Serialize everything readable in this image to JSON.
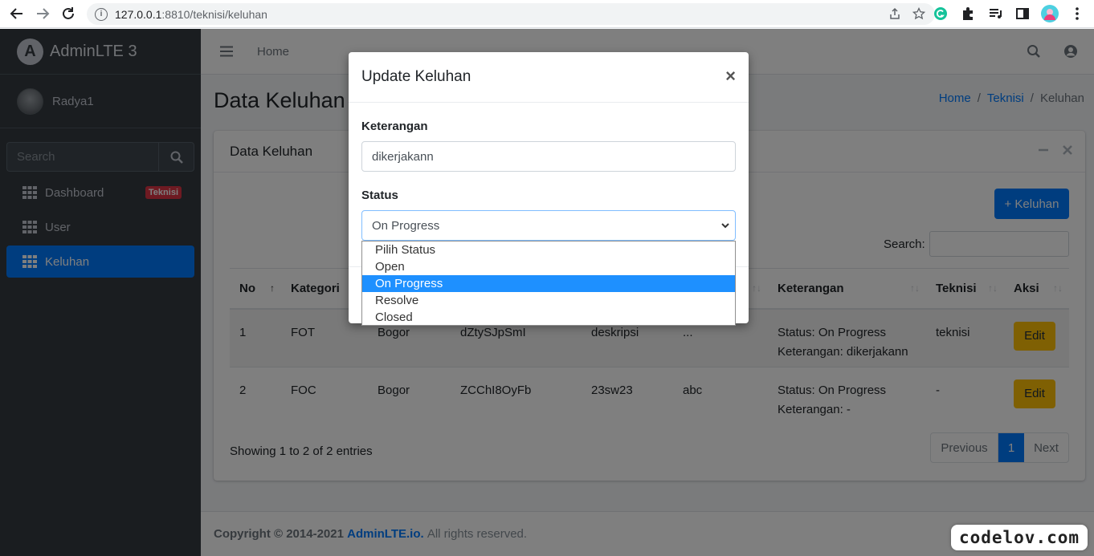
{
  "browser": {
    "url_host": "127.0.0.1",
    "url_path": ":8810/teknisi/keluhan"
  },
  "sidebar": {
    "brand": "AdminLTE 3",
    "user_name": "Radya1",
    "search_placeholder": "Search",
    "items": [
      {
        "label": "Dashboard",
        "badge": "Teknisi"
      },
      {
        "label": "User"
      },
      {
        "label": "Keluhan",
        "active": true
      }
    ]
  },
  "navbar": {
    "home": "Home"
  },
  "page": {
    "title": "Data Keluhan",
    "breadcrumb": [
      "Home",
      "Teknisi",
      "Keluhan"
    ]
  },
  "card": {
    "title": "Data Keluhan",
    "add_button": "+ Keluhan",
    "search_label": "Search:",
    "columns": [
      "No",
      "Kategori",
      "",
      "",
      "",
      "",
      "Keterangan",
      "Teknisi",
      "Aksi"
    ],
    "rows": [
      {
        "no": "1",
        "kategori": "FOT",
        "c3": "Bogor",
        "c4": "dZtySJpSmI",
        "c5": "deskripsi",
        "c6": "...",
        "status": "Status: On Progress",
        "keterangan": "Keterangan: dikerjakann",
        "teknisi": "teknisi",
        "aksi": "Edit"
      },
      {
        "no": "2",
        "kategori": "FOC",
        "c3": "Bogor",
        "c4": "ZCChI8OyFb",
        "c5": "23sw23",
        "c6": "abc",
        "status": "Status: On Progress",
        "keterangan": "Keterangan: -",
        "teknisi": "-",
        "aksi": "Edit"
      }
    ],
    "showing": "Showing 1 to 2 of 2 entries",
    "pager": {
      "prev": "Previous",
      "current": "1",
      "next": "Next"
    }
  },
  "footer": {
    "copyright": "Copyright © 2014-2021",
    "link": "AdminLTE.io.",
    "rights": "All rights reserved."
  },
  "modal": {
    "title": "Update Keluhan",
    "close": "×",
    "keterangan_label": "Keterangan",
    "keterangan_value": "dikerjakann",
    "status_label": "Status",
    "status_value": "On Progress",
    "options": [
      "Pilih Status",
      "Open",
      "On Progress",
      "Resolve",
      "Closed"
    ]
  },
  "watermark": "codelov.com",
  "colors": {
    "primary": "#007bff",
    "sidebar": "#343a40",
    "danger": "#dc3545",
    "warning": "#ffc107"
  }
}
